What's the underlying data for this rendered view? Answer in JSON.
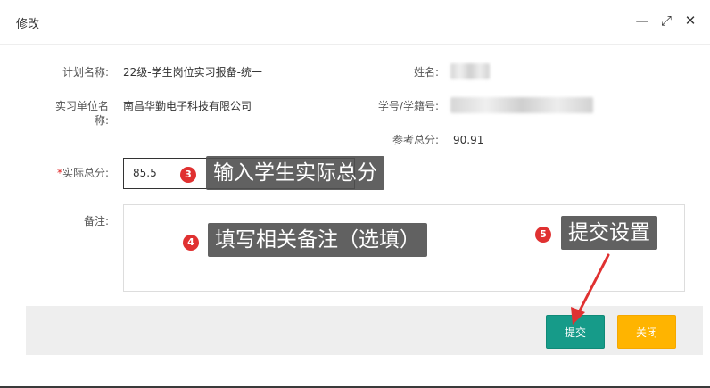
{
  "dialog": {
    "title": "修改",
    "controls": {
      "minimize": "—",
      "maximize": "⤢",
      "close": "✕"
    }
  },
  "form": {
    "plan_name_label": "计划名称:",
    "plan_name_value": "22级-学生岗位实习报备-统一",
    "name_label": "姓名:",
    "company_label_line1": "实习单位名",
    "company_label_line2": "称:",
    "company_value": "南昌华勤电子科技有限公司",
    "student_id_label": "学号/学籍号:",
    "ref_score_label": "参考总分:",
    "ref_score_value": "90.91",
    "actual_score_required_mark": "*",
    "actual_score_label": "实际总分:",
    "actual_score_value": "85.5",
    "note_label": "备注:",
    "note_value": ""
  },
  "annotations": {
    "step3_number": "3",
    "step3_text": "输入学生实际总分",
    "step4_number": "4",
    "step4_text": "填写相关备注（选填）",
    "step5_number": "5",
    "step5_text": "提交设置"
  },
  "buttons": {
    "submit_label": "提交",
    "close_label": "关闭"
  },
  "colors": {
    "submit": "#169b89",
    "close": "#ffb400",
    "badge": "#e03131",
    "arrow": "#e03131"
  }
}
